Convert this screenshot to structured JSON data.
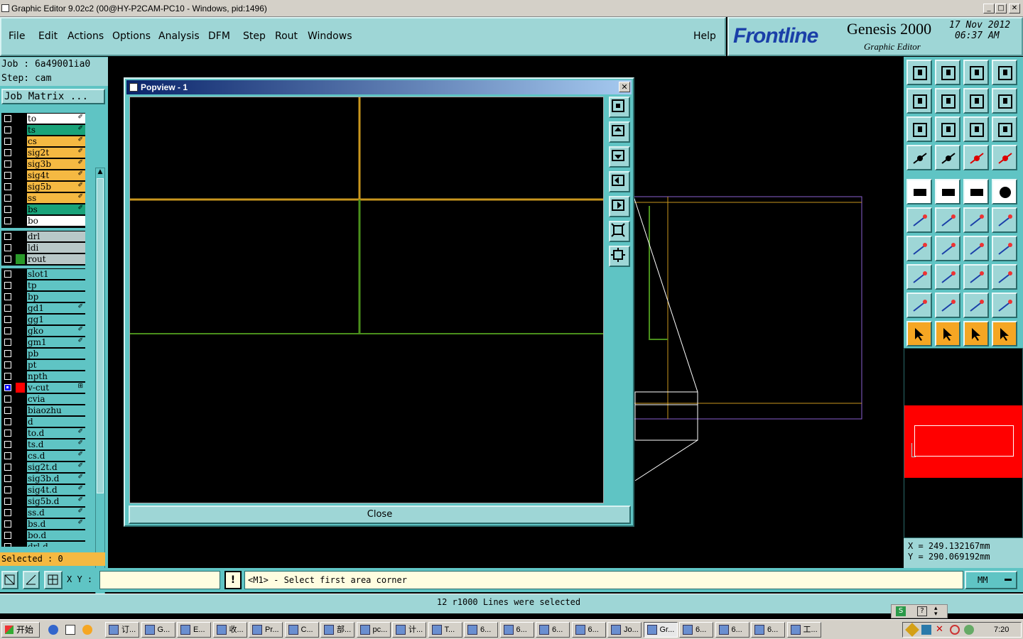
{
  "window": {
    "title": "Graphic Editor 9.02c2 (00@HY-P2CAM-PC10 - Windows, pid:1496)",
    "min_label": "_",
    "max_label": "□",
    "close_label": "✕"
  },
  "menu": {
    "items": [
      "File",
      "Edit",
      "Actions",
      "Options",
      "Analysis",
      "DFM",
      "Step",
      "Rout",
      "Windows"
    ],
    "help": "Help"
  },
  "brand": {
    "logo": "Frontline",
    "product": "Genesis 2000",
    "subtitle": "Graphic Editor",
    "date": "17 Nov 2012",
    "time": "06:37 AM"
  },
  "job": {
    "job_label": "Job : 6a49001ia0",
    "step_label": "Step: cam",
    "matrix_button": "Job Matrix ..."
  },
  "layers": {
    "group1": [
      {
        "name": "to",
        "color": "#ffffff",
        "flag": "✐"
      },
      {
        "name": "ts",
        "color": "#1aa37a",
        "flag": "✐"
      },
      {
        "name": "cs",
        "color": "#f5b942",
        "flag": "✐"
      },
      {
        "name": "sig2t",
        "color": "#f5b942",
        "flag": "✐"
      },
      {
        "name": "sig3b",
        "color": "#f5b942",
        "flag": "✐"
      },
      {
        "name": "sig4t",
        "color": "#f5b942",
        "flag": "✐"
      },
      {
        "name": "sig5b",
        "color": "#f5b942",
        "flag": "✐"
      },
      {
        "name": "ss",
        "color": "#f5b942",
        "flag": "✐"
      },
      {
        "name": "bs",
        "color": "#1aa37a",
        "flag": "✐"
      },
      {
        "name": "bo",
        "color": "#ffffff",
        "flag": ""
      }
    ],
    "group2": [
      {
        "name": "drl",
        "color": "#b8c8c8",
        "flag": ""
      },
      {
        "name": "ldi",
        "color": "#b8c8c8",
        "flag": ""
      },
      {
        "name": "rout",
        "color": "#b8c8c8",
        "flag": ""
      }
    ],
    "group3": [
      {
        "name": "slot1",
        "flag": ""
      },
      {
        "name": "tp",
        "flag": ""
      },
      {
        "name": "bp",
        "flag": ""
      },
      {
        "name": "gd1",
        "flag": "✐"
      },
      {
        "name": "gg1",
        "flag": ""
      },
      {
        "name": "gko",
        "flag": "✐"
      },
      {
        "name": "gm1",
        "flag": "✐"
      },
      {
        "name": "pb",
        "flag": ""
      },
      {
        "name": "pt",
        "flag": ""
      },
      {
        "name": "npth",
        "flag": ""
      },
      {
        "name": "v-cut",
        "flag": "⊞"
      },
      {
        "name": "cvia",
        "flag": ""
      },
      {
        "name": "biaozhu",
        "flag": ""
      },
      {
        "name": "d",
        "flag": ""
      },
      {
        "name": "to.d",
        "flag": "✐"
      },
      {
        "name": "ts.d",
        "flag": "✐"
      },
      {
        "name": "cs.d",
        "flag": "✐"
      },
      {
        "name": "sig2t.d",
        "flag": "✐"
      },
      {
        "name": "sig3b.d",
        "flag": "✐"
      },
      {
        "name": "sig4t.d",
        "flag": "✐"
      },
      {
        "name": "sig5b.d",
        "flag": "✐"
      },
      {
        "name": "ss.d",
        "flag": "✐"
      },
      {
        "name": "bs.d",
        "flag": "✐"
      },
      {
        "name": "bo.d",
        "flag": ""
      },
      {
        "name": "drl.d",
        "flag": ""
      }
    ],
    "selected_count": "Selected : 0"
  },
  "popview": {
    "title": "Popview - 1",
    "close_button": "Close"
  },
  "coords": {
    "x": "X  =  249.132167mm",
    "y": "Y  =  290.069192mm"
  },
  "command": {
    "xy_label": "X Y :",
    "xy_value": "",
    "prompt": "<M1> - Select first area corner",
    "units": "MM"
  },
  "status": {
    "message": "12 r1000 Lines were selected"
  },
  "taskbar": {
    "start": "开始",
    "tasks": [
      "订...",
      "G...",
      "E...",
      "收...",
      "Pr...",
      "C...",
      "部...",
      "pc...",
      "计...",
      "T...",
      "6...",
      "6...",
      "6...",
      "6...",
      "Jo...",
      "Gr...",
      "6...",
      "6...",
      "6...",
      "工..."
    ],
    "clock": "7:20"
  },
  "colors": {
    "panel_teal": "#5fc4c4",
    "light_teal": "#9ed6d6",
    "cross_orange": "#c8961e",
    "cross_green": "#4a8f1c",
    "minimap_red": "#ff0000"
  }
}
